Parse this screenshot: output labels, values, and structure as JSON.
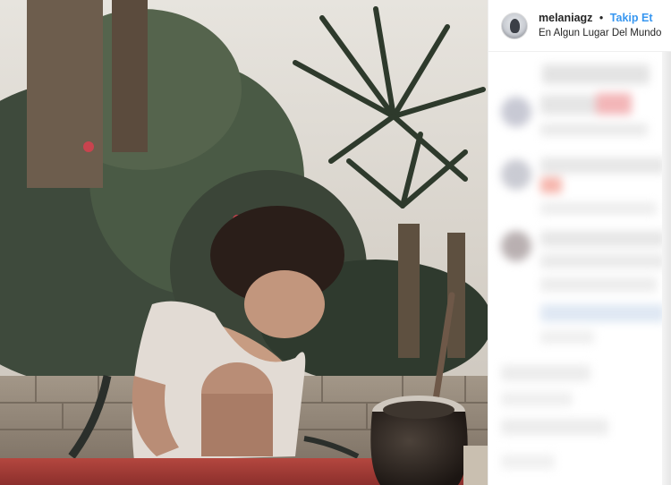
{
  "post": {
    "header": {
      "username": "melaniagz",
      "separator": "•",
      "follow_label": "Takip Et",
      "location": "En Algun Lugar Del Mundo"
    }
  },
  "icons": {
    "avatar": "profile-avatar"
  },
  "colors": {
    "follow": "#3897f0",
    "text": "#262626",
    "border": "#efefef",
    "table": "#b0433f"
  }
}
